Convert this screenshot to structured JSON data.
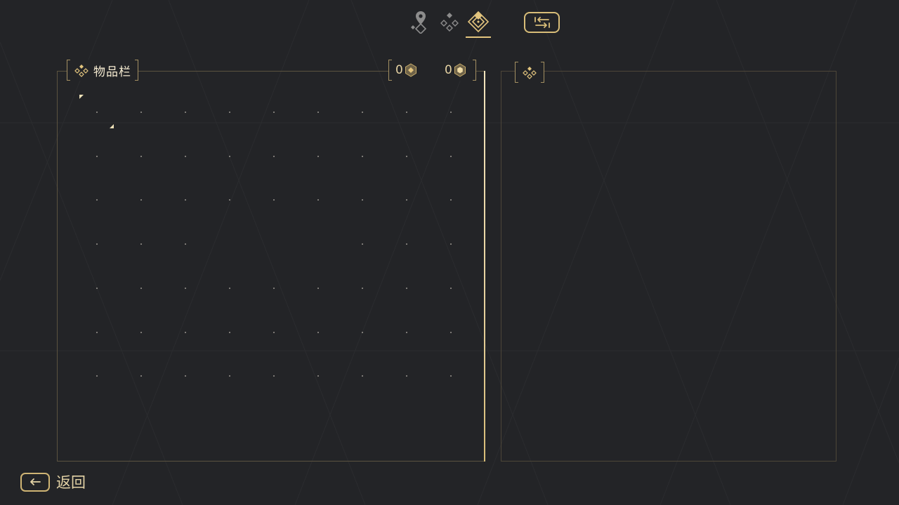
{
  "tabs": [
    {
      "id": "map",
      "icon": "map-pin-icon",
      "active": false
    },
    {
      "id": "route",
      "icon": "diamond-network-icon",
      "active": false
    },
    {
      "id": "inventory",
      "icon": "diamond-target-icon",
      "active": true
    }
  ],
  "toolbar": {
    "switch_icon": "swap-arrows-icon"
  },
  "inventory": {
    "title": "物品栏",
    "icon": "diamond-cluster-icon",
    "grid": {
      "rows": 7,
      "cols": 9
    }
  },
  "currencies": [
    {
      "value": "0",
      "icon": "hex-coin-icon"
    },
    {
      "value": "0",
      "icon": "hex-gem-icon"
    }
  ],
  "detail_panel": {
    "icon": "diamond-cluster-icon"
  },
  "back": {
    "label": "返回",
    "icon": "arrow-left-icon"
  },
  "colors": {
    "accent": "#e3c57e",
    "background": "#232427",
    "panel_border": "#5c5340"
  }
}
